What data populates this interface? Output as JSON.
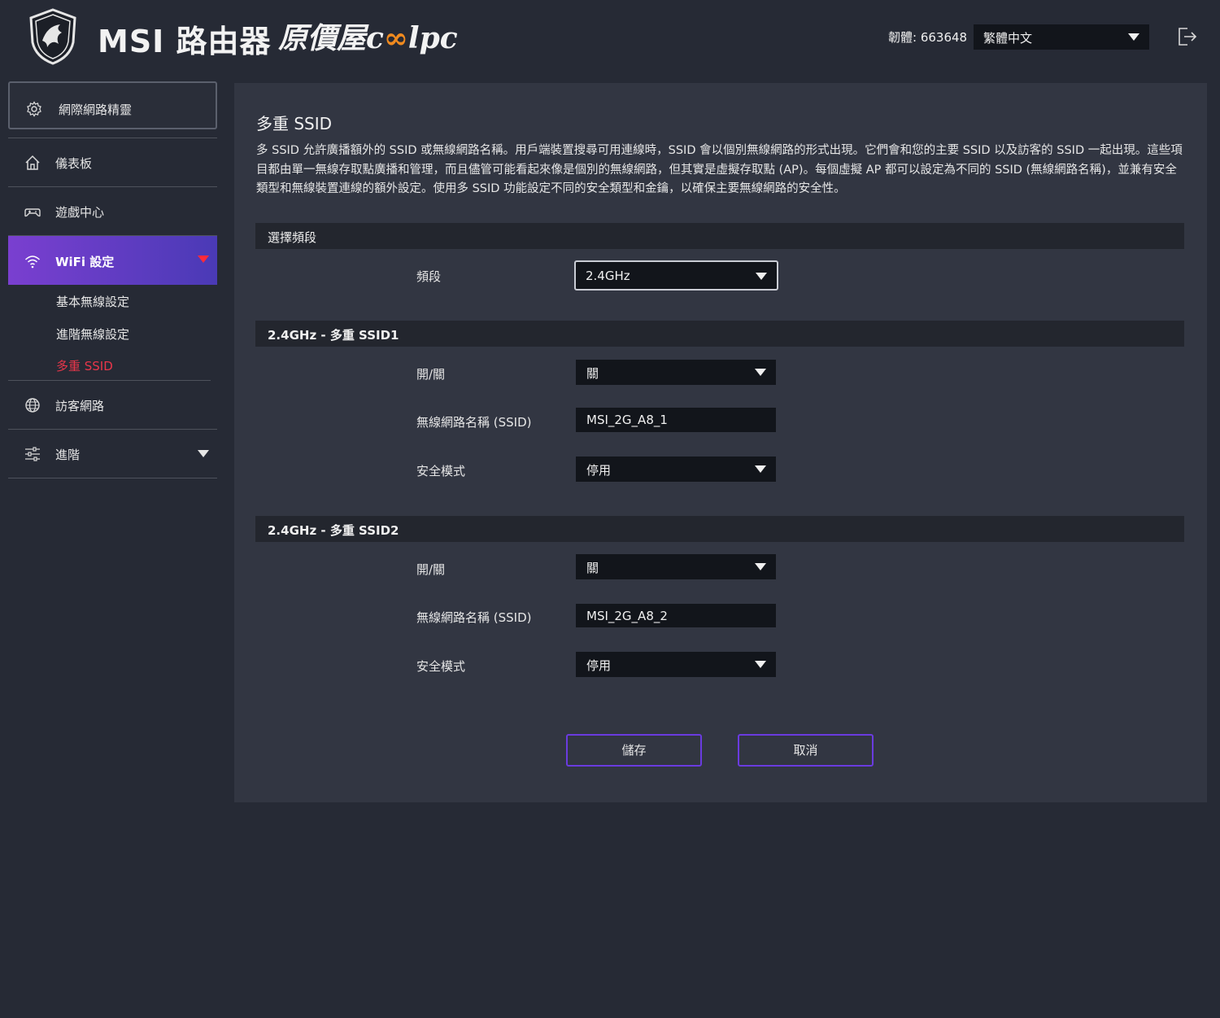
{
  "header": {
    "brand": "MSI 路由器",
    "watermark_left": "原價屋c",
    "watermark_right": "lpc",
    "firmware": "韌體: 663648",
    "language": "繁體中文"
  },
  "sidebar": {
    "wizard": "網際網路精靈",
    "items": [
      {
        "label": "儀表板",
        "icon": "home-icon"
      },
      {
        "label": "遊戲中心",
        "icon": "gamepad-icon"
      },
      {
        "label": "WiFi 設定",
        "icon": "wifi-icon"
      },
      {
        "label": "訪客網路",
        "icon": "globe-icon"
      },
      {
        "label": "進階",
        "icon": "sliders-icon"
      }
    ],
    "wifi_sub": [
      "基本無線設定",
      "進階無線設定",
      "多重 SSID"
    ]
  },
  "main": {
    "title": "多重 SSID",
    "description": "多 SSID 允許廣播額外的 SSID 或無線網路名稱。用戶端裝置搜尋可用連線時，SSID 會以個別無線網路的形式出現。它們會和您的主要 SSID 以及訪客的 SSID 一起出現。這些項目都由單一無線存取點廣播和管理，而且儘管可能看起來像是個別的無線網路，但其實是虛擬存取點 (AP)。每個虛擬 AP 都可以設定為不同的 SSID (無線網路名稱)，並兼有安全類型和無線裝置連線的額外設定。使用多 SSID 功能設定不同的安全類型和金鑰，以確保主要無線網路的安全性。",
    "band_section": {
      "title": "選擇頻段",
      "label": "頻段",
      "value": "2.4GHz"
    },
    "ssid1": {
      "title": "2.4GHz - 多重 SSID1",
      "onoff_label": "開/關",
      "onoff_value": "關",
      "name_label": "無線網路名稱 (SSID)",
      "name_value": "MSI_2G_A8_1",
      "security_label": "安全模式",
      "security_value": "停用"
    },
    "ssid2": {
      "title": "2.4GHz - 多重 SSID2",
      "onoff_label": "開/關",
      "onoff_value": "關",
      "name_label": "無線網路名稱 (SSID)",
      "name_value": "MSI_2G_A8_2",
      "security_label": "安全模式",
      "security_value": "停用"
    },
    "save_label": "儲存",
    "cancel_label": "取消"
  },
  "colors": {
    "background": "#262a35",
    "panel": "#323642",
    "accent_purple": "#6a3be0",
    "active_red": "#e8364a",
    "watermark_orange": "#f08a1f"
  }
}
